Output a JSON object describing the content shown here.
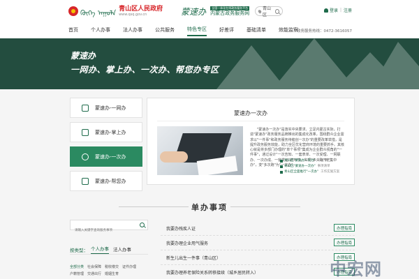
{
  "header": {
    "mongolian_script": "ᠬᠥᠬᠡ ᠠᠭᠤᠯᠠ",
    "gov_name": "青山区人民政府",
    "gov_url": "www.qsq.gov.cn",
    "calligraphy": "蒙速办",
    "service_badge": "全国一体化在线政务服务平台",
    "service_name": "内蒙古政务服务网",
    "region": "青山区",
    "login": "登录",
    "register": "注册"
  },
  "nav": {
    "items": [
      "首页",
      "个人办事",
      "法人办事",
      "公共服务",
      "特色专区",
      "好差评",
      "基础清单",
      "效能监察"
    ],
    "active_index": 4,
    "hotline": "政务服务热线：0472-3616057"
  },
  "banner": {
    "title": "蒙速办",
    "slogan": "一网办、掌上办、一次办、帮您办专区"
  },
  "side_menu": {
    "items": [
      "蒙速办-一网办",
      "蒙速办-掌上办",
      "蒙速办-一次办",
      "蒙速办-帮您办"
    ],
    "active_index": 2
  },
  "panel": {
    "title": "蒙速办一次办",
    "body": "\"蒙速办一次办\"是落实中央要求、立足内蒙古实际，打造\"蒙速办\"政务服务品牌推出的集成化改革，围绕群众企业需求以\"一件事\"和政务服务待催创一次办\"的重要改革举措，是提升政务服务效能，助力全区优化营商环境的重要抓手。其核心就是将多部门办理的\"单个事项\"集成为企业群众视角的\"一件事\"，通过设计\"一次告知、一套表单、一次受理、一网联办、一次办成、一窗发证\"的环节，实现\"多头跑\"到\"集中办\"，变\"多次跑\"为\"一次办\"。",
    "links": [
      {
        "text": "青山区\"蒙速办一次办\"",
        "download": "下载专区"
      },
      {
        "text": "青山区\"蒙速办一次办\"",
        "download": "事项清单"
      },
      {
        "text": "青山区全面推行\"一次办\"",
        "download": "工作实施方案"
      }
    ]
  },
  "section": {
    "title": "单办事项"
  },
  "filter": {
    "search_placeholder": "请输入关键字查询服务事项",
    "label": "按类型：",
    "tabs": [
      "个人办事",
      "法人办事"
    ],
    "categories": [
      "全部分类",
      "社会保障",
      "税收缴交",
      "证件办理",
      "户籍管理",
      "交通出行",
      "婚姻生育"
    ],
    "active_category": 0
  },
  "items": {
    "rows": [
      {
        "name": "我要办残疾人证",
        "action": "办理指南"
      },
      {
        "name": "我要办理企业用气服务",
        "action": "办理指南"
      },
      {
        "name": "新生儿出生一件事（青山区）",
        "action": "办理指南"
      },
      {
        "name": "我要办理养老保险关系转移接续（城乡居民转入）",
        "action": "办理指南"
      }
    ]
  },
  "watermark": {
    "text": "中宏网"
  },
  "colors": {
    "brand_green": "#1e6b4b",
    "active_green": "#2b8a61",
    "banner_bg": "#234d3f",
    "gov_red": "#d7262a"
  }
}
